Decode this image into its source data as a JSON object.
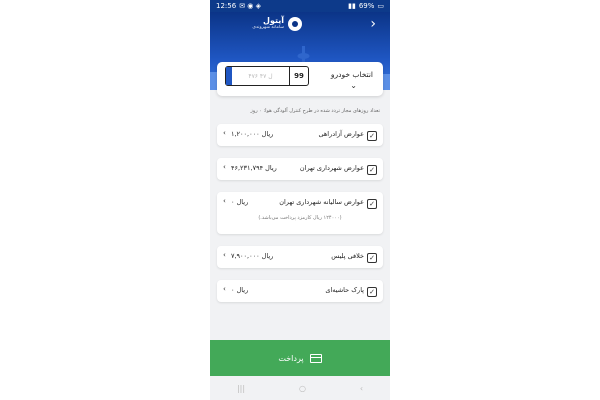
{
  "status_bar": {
    "time": "12:56",
    "battery": "69%"
  },
  "header": {
    "app_name": "آیتول",
    "app_subtitle": "سامانه شهروندی"
  },
  "vehicle": {
    "label": "انتخاب خودرو",
    "plate_code": "99",
    "plate_digits": "۴۷۶ ل ۴۷"
  },
  "note": "تعداد روزهای مجاز تردد شده در طرح کنترل آلودگی هوا: ۰ روز",
  "items": [
    {
      "title": "عوارض آزادراهی",
      "amount": "۱,۲۰۰,۰۰۰ ریال"
    },
    {
      "title": "عوارض شهرداری تهران",
      "amount": "۴۶,۲۳۱,۷۹۴ ریال"
    },
    {
      "title": "عوارض سالیانه شهرداری تهران",
      "amount": "۰ ریال",
      "sub": "(۱۲۴۰۰۰ ریال کارمزد پرداخت می‌باشد.)"
    },
    {
      "title": "خلافی پلیس",
      "amount": "۷,۹۰۰,۰۰۰ ریال"
    },
    {
      "title": "پارک حاشیه‌ای",
      "amount": "۰ ریال"
    }
  ],
  "pay_button": {
    "label": "پرداخت"
  },
  "colors": {
    "header": "#0b3487",
    "pay": "#43a958"
  }
}
